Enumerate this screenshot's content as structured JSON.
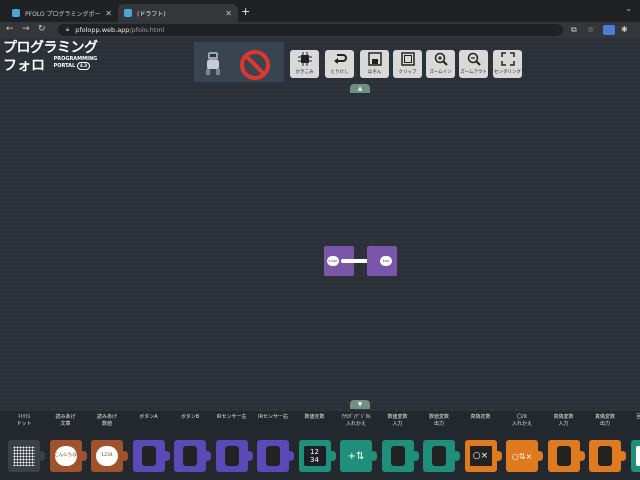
{
  "browser": {
    "tabs": [
      {
        "title": "PFOLO プログラミングポータル",
        "active": false
      },
      {
        "title": "(ドラフト)",
        "active": true
      }
    ],
    "new_tab": "+",
    "url_host": "pfolopp.web.app",
    "url_path": "/pfolo.html"
  },
  "logo": {
    "line1": "プログラミング",
    "line2": "フォロ",
    "sub1": "PROGRAMMING",
    "sub2": "PORTAL",
    "version": "4.3"
  },
  "toolbar_buttons": [
    {
      "label": "かきこみ",
      "icon": "chip-icon"
    },
    {
      "label": "とりけし",
      "icon": "undo-icon"
    },
    {
      "label": "ほぞん",
      "icon": "save-icon"
    },
    {
      "label": "クリップ",
      "icon": "clip-icon"
    },
    {
      "label": "ズームイン",
      "icon": "zoom-in-icon"
    },
    {
      "label": "ズームアウト",
      "icon": "zoom-out-icon"
    },
    {
      "label": "センタリング",
      "icon": "center-icon"
    }
  ],
  "canvas": {
    "start_label": "START",
    "end_label": "END"
  },
  "palette": [
    {
      "label": "ﾏﾄﾘｸｽ\nドット",
      "color": "#3b3f47",
      "icon": "matrix-icon"
    },
    {
      "label": "読みあげ\n文章",
      "color": "#a0522d",
      "icon": "speech-text-icon",
      "text": "こんにちは"
    },
    {
      "label": "読みあげ\n数値",
      "color": "#a0522d",
      "icon": "speech-number-icon",
      "text": "1234"
    },
    {
      "label": "ボタンA",
      "color": "#5b49b8",
      "icon": "button-a-icon"
    },
    {
      "label": "ボタンB",
      "color": "#5b49b8",
      "icon": "button-b-icon"
    },
    {
      "label": "IRセンサー左",
      "color": "#5b49b8",
      "icon": "ir-left-icon"
    },
    {
      "label": "IRセンサー右",
      "color": "#5b49b8",
      "icon": "ir-right-icon"
    },
    {
      "label": "数値定数",
      "color": "#1f8f7a",
      "icon": "number-icon",
      "text": "12\n34"
    },
    {
      "label": "ｱﾅﾛｸﾞ/ﾃﾞｼﾞﾀﾙ\n入れかえ",
      "color": "#1f8f7a",
      "icon": "analog-digital-icon"
    },
    {
      "label": "数値変数\n入力",
      "color": "#1f8f7a",
      "icon": "number-var-in-icon"
    },
    {
      "label": "数値変数\n出力",
      "color": "#1f8f7a",
      "icon": "number-var-out-icon"
    },
    {
      "label": "真偽定数",
      "color": "#e07a1f",
      "icon": "bool-const-icon"
    },
    {
      "label": "〇/X\n入れかえ",
      "color": "#e07a1f",
      "icon": "bool-swap-icon"
    },
    {
      "label": "真偽変数\n入力",
      "color": "#e07a1f",
      "icon": "bool-var-in-icon"
    },
    {
      "label": "真偽変数\n出力",
      "color": "#e07a1f",
      "icon": "bool-var-out-icon"
    },
    {
      "label": "回数ルー",
      "color": "#1f8f7a",
      "icon": "loop-icon"
    }
  ]
}
